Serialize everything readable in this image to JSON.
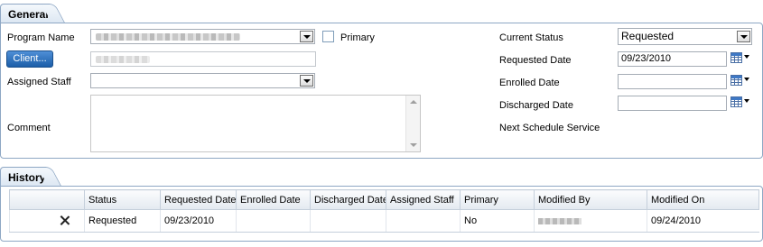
{
  "general": {
    "tab_label": "General",
    "program_name_label": "Program Name",
    "primary_label": "Primary",
    "primary_checked": false,
    "client_button_label": "Client...",
    "assigned_staff_label": "Assigned Staff",
    "assigned_staff_value": "",
    "comment_label": "Comment",
    "comment_value": "",
    "current_status_label": "Current Status",
    "current_status_value": "Requested",
    "requested_date_label": "Requested Date",
    "requested_date_value": "09/23/2010",
    "enrolled_date_label": "Enrolled Date",
    "enrolled_date_value": "",
    "discharged_date_label": "Discharged Date",
    "discharged_date_value": "",
    "next_schedule_label": "Next Schedule Service"
  },
  "history": {
    "tab_label": "History",
    "columns": [
      "",
      "Status",
      "Requested Date",
      "Enrolled Date",
      "Discharged Date",
      "Assigned Staff",
      "Primary",
      "Modified By",
      "Modified On"
    ],
    "rows": [
      {
        "status": "Requested",
        "requested_date": "09/23/2010",
        "enrolled_date": "",
        "discharged_date": "",
        "assigned_staff": "",
        "primary": "No",
        "modified_on": "09/24/2010"
      }
    ]
  },
  "icons": {
    "delete": "close-icon",
    "calendar": "calendar-icon",
    "dropdown": "chevron-down-icon"
  },
  "colors": {
    "accent": "#1b5ea8",
    "border": "#8ea7c4"
  }
}
